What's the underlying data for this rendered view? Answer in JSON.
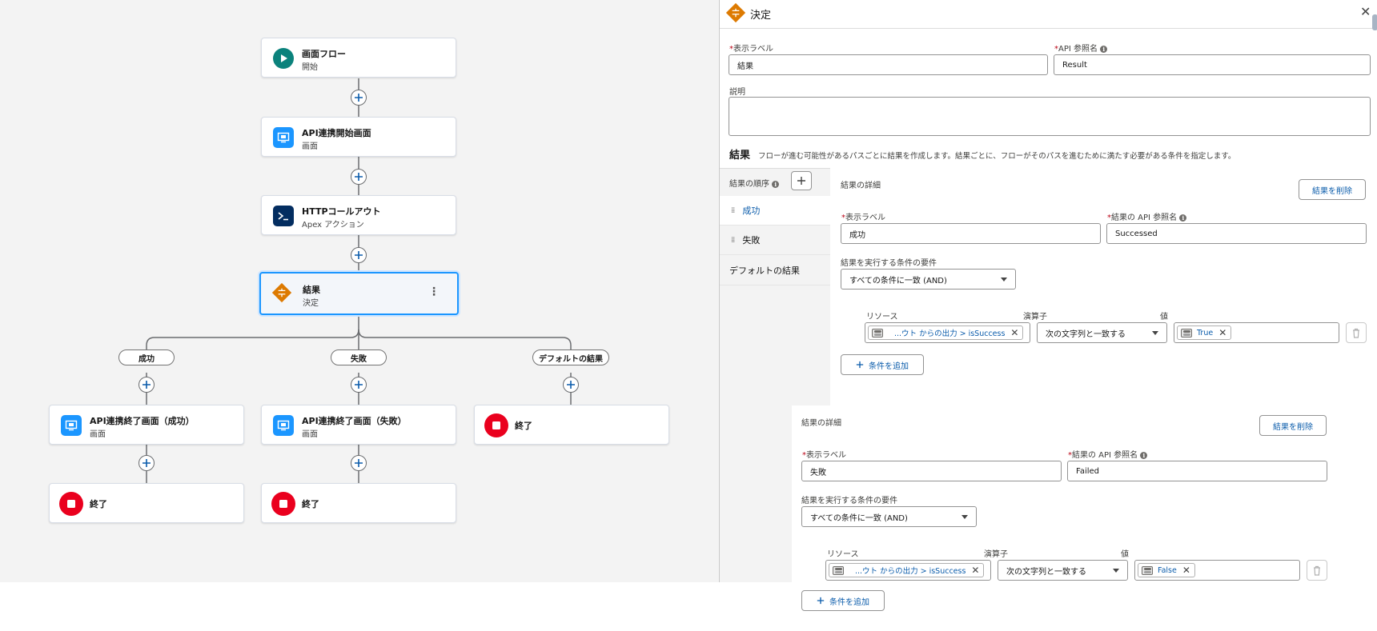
{
  "canvas": {
    "nodes": {
      "start": {
        "title": "画面フロー",
        "subtitle": "開始"
      },
      "screen1": {
        "title": "API連携開始画面",
        "subtitle": "画面"
      },
      "http": {
        "title": "HTTPコールアウト",
        "subtitle": "Apex アクション"
      },
      "decision": {
        "title": "結果",
        "subtitle": "決定"
      },
      "screen_success": {
        "title": "API連携終了画面（成功）",
        "subtitle": "画面"
      },
      "screen_fail": {
        "title": "API連携終了画面（失敗）",
        "subtitle": "画面"
      },
      "end_default": {
        "title": "終了"
      },
      "end_success": {
        "title": "終了"
      },
      "end_fail": {
        "title": "終了"
      }
    },
    "branches": {
      "success": "成功",
      "fail": "失敗",
      "default": "デフォルトの結果"
    }
  },
  "panel": {
    "header_title": "決定",
    "label_label": "表示ラベル",
    "label_value": "結果",
    "api_label": "API 参照名",
    "api_value": "Result",
    "description_label": "説明",
    "outcomes_heading": "結果",
    "outcomes_help": "フローが進む可能性があるパスごとに結果を作成します。結果ごとに、フローがそのパスを進むために満たす必要がある条件を指定します。",
    "order_label": "結果の順序",
    "nav_items": [
      "成功",
      "失敗",
      "デフォルトの結果"
    ],
    "outcome_success": {
      "details_label": "結果の詳細",
      "delete_button": "結果を削除",
      "label_label": "表示ラベル",
      "label_value": "成功",
      "api_label": "結果の API 参照名",
      "api_value": "Successed",
      "condition_req_label": "結果を実行する条件の要件",
      "condition_req_value": "すべての条件に一致 (AND)",
      "resource_label": "リソース",
      "operator_label": "演算子",
      "value_label": "値",
      "resource_value": "...ウト からの出力 > isSuccess",
      "operator_value": "次の文字列と一致する",
      "value_value": "True",
      "add_condition": "条件を追加"
    },
    "outcome_fail": {
      "details_label": "結果の詳細",
      "delete_button": "結果を削除",
      "label_label": "表示ラベル",
      "label_value": "失敗",
      "api_label": "結果の API 参照名",
      "api_value": "Failed",
      "condition_req_label": "結果を実行する条件の要件",
      "condition_req_value": "すべての条件に一致 (AND)",
      "resource_label": "リソース",
      "operator_label": "演算子",
      "value_label": "値",
      "resource_value": "...ウト からの出力 > isSuccess",
      "operator_value": "次の文字列と一致する",
      "value_value": "False",
      "add_condition": "条件を追加"
    }
  },
  "colors": {
    "start_icon": "#0b827c",
    "screen_icon": "#1b96ff",
    "apex_icon": "#032d60",
    "decision_icon": "#dd7a01",
    "end_icon": "#ea001e",
    "link_blue": "#0b5cab",
    "selected_border": "#1b96ff"
  },
  "icons": [
    "play-icon",
    "screen-icon",
    "terminal-icon",
    "decision-icon",
    "stop-icon",
    "plus-icon",
    "close-icon",
    "info-icon",
    "trash-icon",
    "toggle-icon",
    "kebab-icon",
    "drag-handle-icon"
  ]
}
